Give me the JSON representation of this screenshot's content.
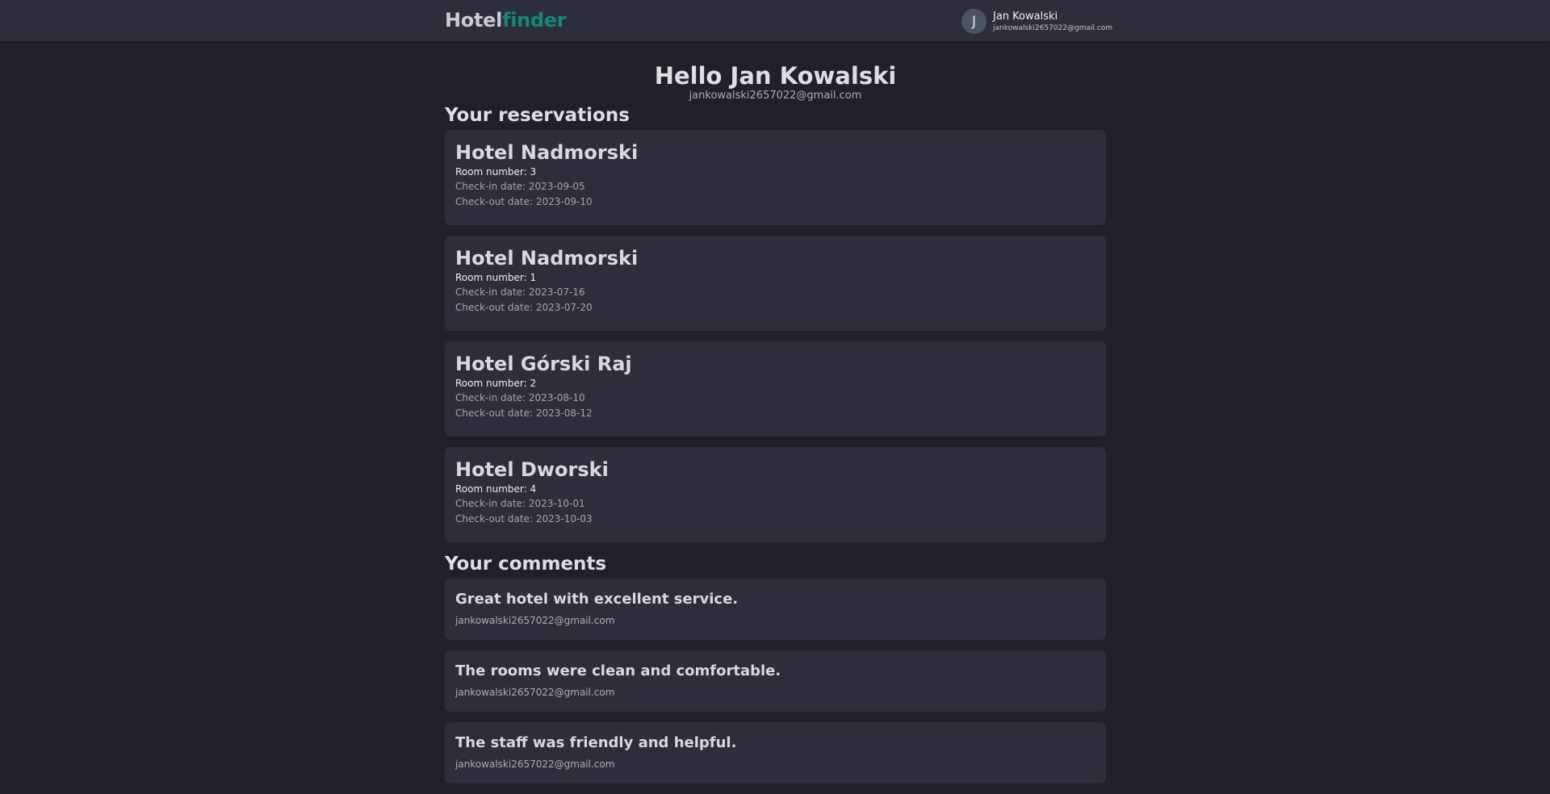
{
  "header": {
    "logo_part1": "Hotel",
    "logo_part2": "finder",
    "user": {
      "initial": "J",
      "name": "Jan Kowalski",
      "email": "jankowalski2657022@gmail.com"
    }
  },
  "profile": {
    "greeting": "Hello Jan Kowalski",
    "email": "jankowalski2657022@gmail.com"
  },
  "reservations": {
    "title": "Your reservations",
    "items": [
      {
        "hotel": "Hotel Nadmorski",
        "room": "Room number: 3",
        "checkin": "Check-in date: 2023-09-05",
        "checkout": "Check-out date: 2023-09-10"
      },
      {
        "hotel": "Hotel Nadmorski",
        "room": "Room number: 1",
        "checkin": "Check-in date: 2023-07-16",
        "checkout": "Check-out date: 2023-07-20"
      },
      {
        "hotel": "Hotel Górski Raj",
        "room": "Room number: 2",
        "checkin": "Check-in date: 2023-08-10",
        "checkout": "Check-out date: 2023-08-12"
      },
      {
        "hotel": "Hotel Dworski",
        "room": "Room number: 4",
        "checkin": "Check-in date: 2023-10-01",
        "checkout": "Check-out date: 2023-10-03"
      }
    ]
  },
  "comments": {
    "title": "Your comments",
    "items": [
      {
        "text": "Great hotel with excellent service.",
        "author": "jankowalski2657022@gmail.com"
      },
      {
        "text": "The rooms were clean and comfortable.",
        "author": "jankowalski2657022@gmail.com"
      },
      {
        "text": "The staff was friendly and helpful.",
        "author": "jankowalski2657022@gmail.com"
      }
    ]
  }
}
